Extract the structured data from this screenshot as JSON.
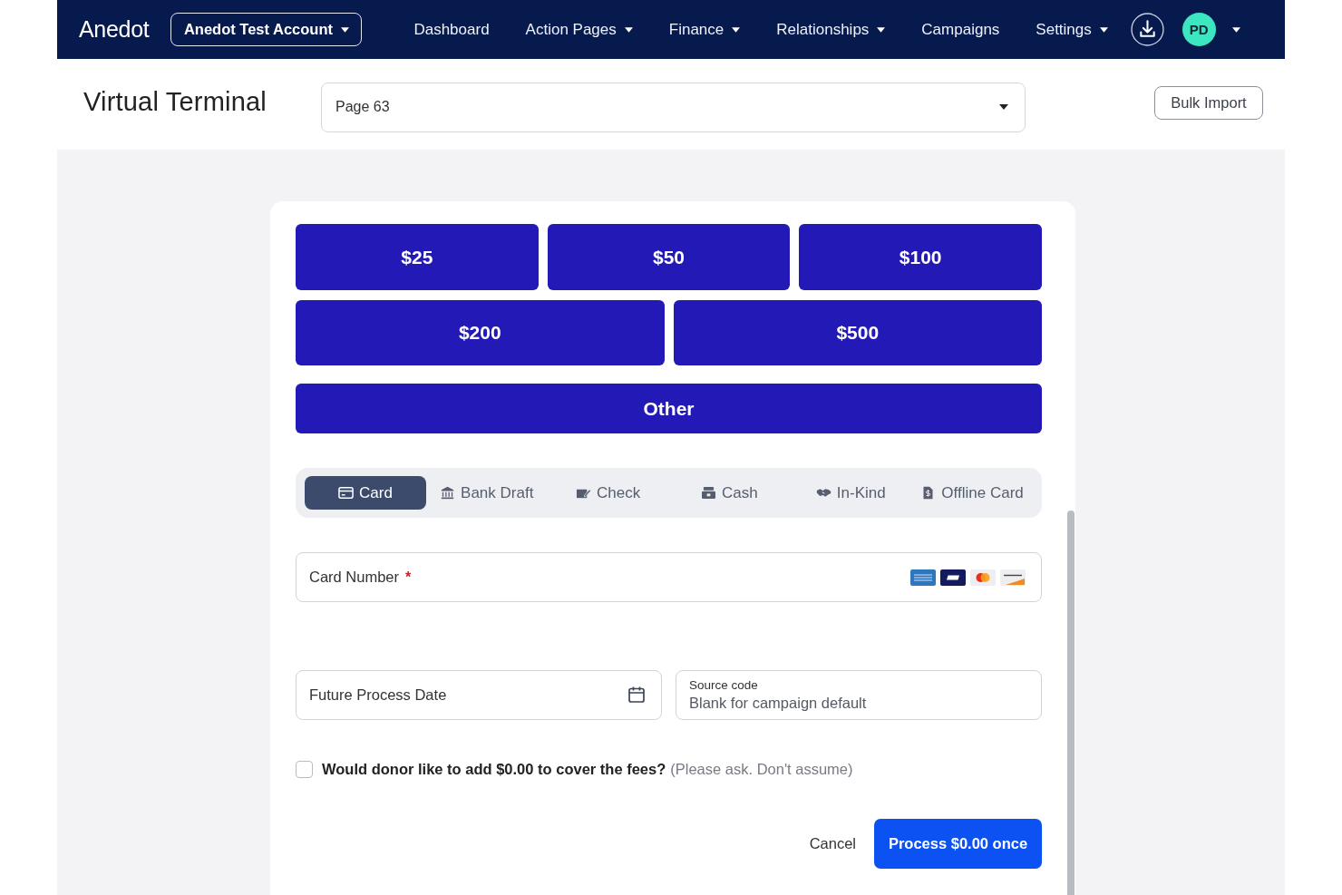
{
  "nav": {
    "logo": "Anedot",
    "account": "Anedot Test Account",
    "items": [
      {
        "label": "Dashboard",
        "has_menu": false
      },
      {
        "label": "Action Pages",
        "has_menu": true
      },
      {
        "label": "Finance",
        "has_menu": true
      },
      {
        "label": "Relationships",
        "has_menu": true
      },
      {
        "label": "Campaigns",
        "has_menu": false
      },
      {
        "label": "Settings",
        "has_menu": true
      }
    ],
    "avatar": "PD"
  },
  "header": {
    "title": "Virtual Terminal",
    "page_select": "Page 63",
    "bulk_import": "Bulk Import"
  },
  "amount_rows": [
    [
      "$25",
      "$50",
      "$100"
    ],
    [
      "$200",
      "$500"
    ],
    [
      "Other"
    ]
  ],
  "payment_tabs": [
    {
      "label": "Card",
      "kind": "card",
      "selected": true
    },
    {
      "label": "Bank Draft",
      "kind": "bank",
      "selected": false
    },
    {
      "label": "Check",
      "kind": "cheque",
      "selected": false
    },
    {
      "label": "Cash",
      "kind": "cash",
      "selected": false
    },
    {
      "label": "In-Kind",
      "kind": "inkind",
      "selected": false
    },
    {
      "label": "Offline Card",
      "kind": "offline",
      "selected": false
    }
  ],
  "card_number": {
    "label": "Card Number",
    "required_mark": "*"
  },
  "future_date": {
    "placeholder": "Future Process Date"
  },
  "source_code": {
    "label": "Source code",
    "placeholder": "Blank for campaign default"
  },
  "fees": {
    "checked": false,
    "question": "Would donor like to add $0.00 to cover the fees?",
    "note": "(Please ask. Don't assume)"
  },
  "actions": {
    "cancel": "Cancel",
    "process": "Process $0.00 once"
  }
}
